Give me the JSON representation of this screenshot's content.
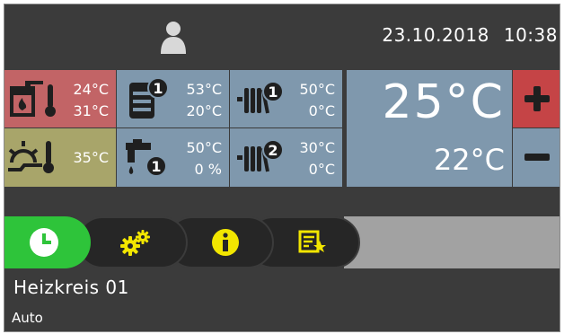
{
  "header": {
    "date": "23.10.2018",
    "time": "10:38",
    "user_icon": "user-icon"
  },
  "tiles": {
    "boiler": {
      "icon": "boiler-thermometer-icon",
      "value1": "24°C",
      "value2": "31°C",
      "color": "#c26466"
    },
    "storage_1": {
      "icon": "storage-tank-1-icon",
      "badge": "1",
      "value1": "53°C",
      "value2": "20°C",
      "color": "#7f98ad"
    },
    "heating_circuit_1": {
      "icon": "radiator-1-icon",
      "badge": "1",
      "value1": "50°C",
      "value2": "0°C",
      "color": "#7f98ad"
    },
    "outdoor": {
      "icon": "sun-thermometer-icon",
      "value1": "35°C",
      "color": "#a8a56a"
    },
    "hot_water_1": {
      "icon": "tap-1-icon",
      "badge": "1",
      "value1": "50°C",
      "value2": "0 %",
      "color": "#7f98ad"
    },
    "heating_circuit_2": {
      "icon": "radiator-2-icon",
      "badge": "2",
      "value1": "30°C",
      "value2": "0°C",
      "color": "#7f98ad"
    }
  },
  "room": {
    "setpoint": "25°C",
    "actual": "22°C",
    "plus_icon": "plus-icon",
    "minus_icon": "minus-icon",
    "plus_color": "#c54446"
  },
  "tabs": [
    {
      "icon": "clock-icon",
      "active": true,
      "color": "#2ec43a"
    },
    {
      "icon": "gears-icon",
      "active": false,
      "color": "#262626"
    },
    {
      "icon": "info-icon",
      "active": false,
      "color": "#262626"
    },
    {
      "icon": "notes-star-icon",
      "active": false,
      "color": "#262626"
    }
  ],
  "accent_yellow": "#f2e600",
  "circuit": {
    "title": "Heizkreis 01",
    "mode": "Auto"
  }
}
